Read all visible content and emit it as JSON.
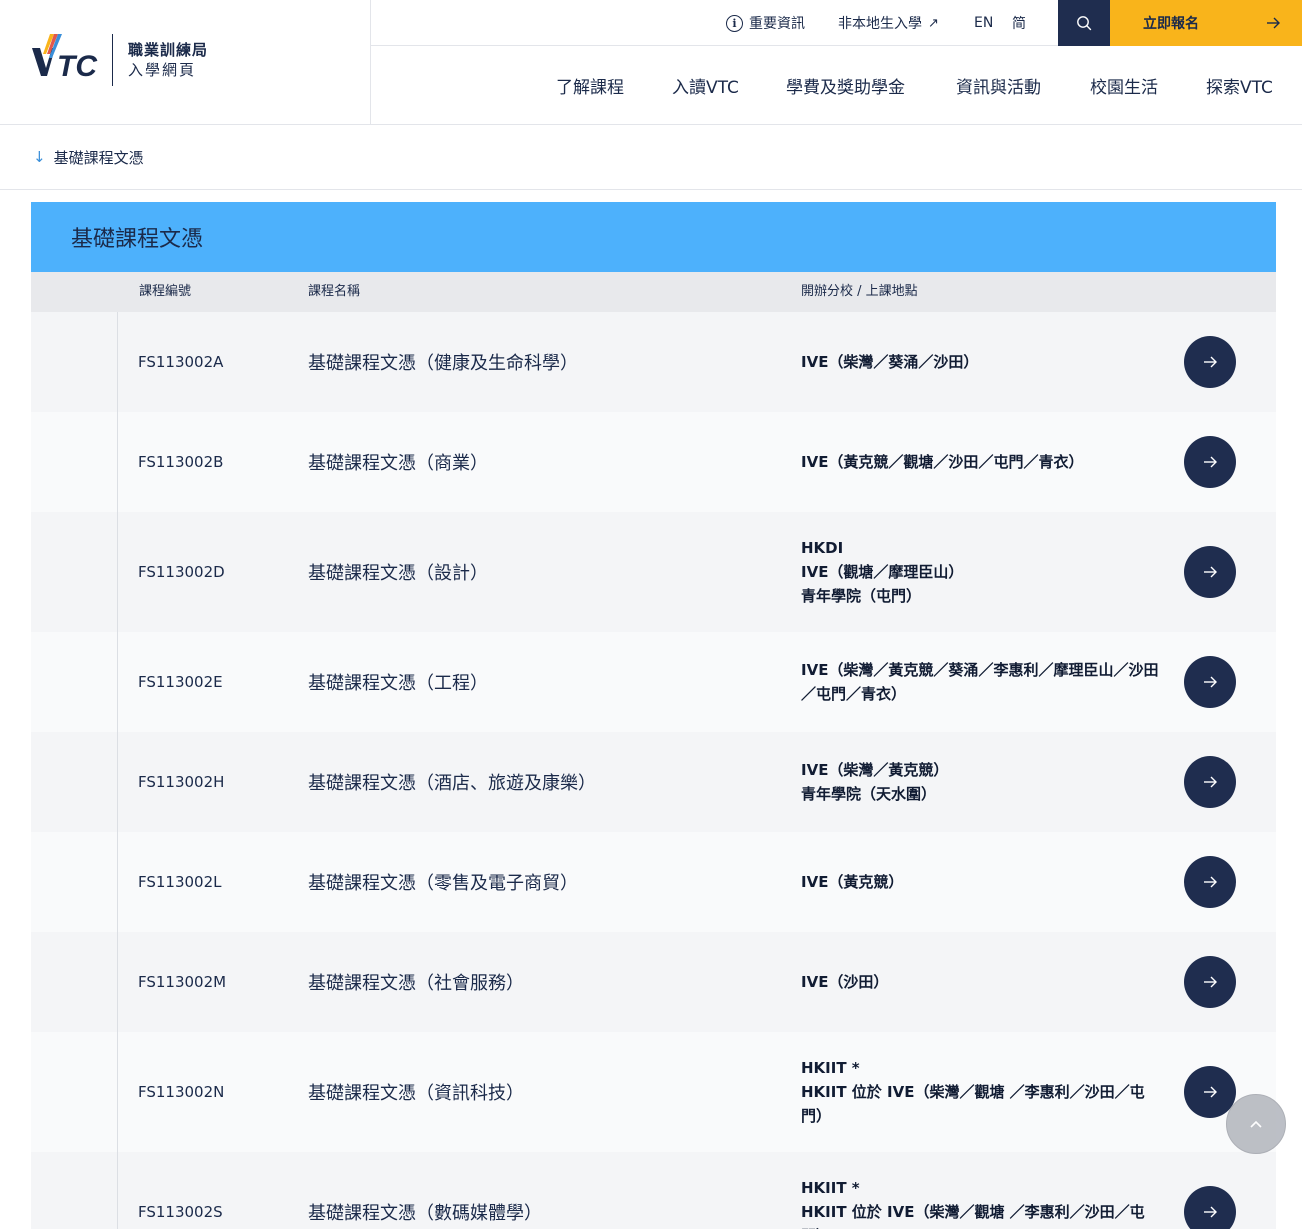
{
  "brand": {
    "logo_text": "VTC",
    "line1": "職業訓練局",
    "line2": "入學網頁",
    "accent_blue": "#4db1fc",
    "navy": "#1f2d4f",
    "yellow": "#f9b41b"
  },
  "topbar": {
    "important_info": "重要資訊",
    "non_local": "非本地生入學",
    "lang_en": "EN",
    "lang_sc": "简",
    "apply_now": "立即報名",
    "icons": [
      "info-icon",
      "external-link-icon",
      "search-icon",
      "arrow-right-icon"
    ]
  },
  "nav": {
    "items": [
      "了解課程",
      "入讀VTC",
      "學費及獎助學金",
      "資訊與活動",
      "校園生活",
      "探索VTC"
    ]
  },
  "anchor": {
    "label": "基礎課程文憑"
  },
  "section": {
    "title": "基礎課程文憑",
    "headers": {
      "code": "課程編號",
      "name": "課程名稱",
      "campus": "開辦分校 / 上課地點"
    },
    "rows": [
      {
        "code": "FS113002A",
        "name": "基礎課程文憑（健康及生命科學）",
        "campus": [
          "IVE（柴灣／葵涌／沙田）"
        ]
      },
      {
        "code": "FS113002B",
        "name": "基礎課程文憑（商業）",
        "campus": [
          "IVE（黃克競／觀塘／沙田／屯門／青衣）"
        ]
      },
      {
        "code": "FS113002D",
        "name": "基礎課程文憑（設計）",
        "campus": [
          "HKDI",
          "IVE（觀塘／摩理臣山）",
          "青年學院（屯門）"
        ]
      },
      {
        "code": "FS113002E",
        "name": "基礎課程文憑（工程）",
        "campus": [
          "IVE（柴灣／黃克競／葵涌／李惠利／摩理臣山／沙田／屯門／青衣）"
        ]
      },
      {
        "code": "FS113002H",
        "name": "基礎課程文憑（酒店、旅遊及康樂）",
        "campus": [
          "IVE（柴灣／黃克競）",
          "青年學院（天水圍）"
        ]
      },
      {
        "code": "FS113002L",
        "name": "基礎課程文憑（零售及電子商貿）",
        "campus": [
          "IVE（黃克競）"
        ]
      },
      {
        "code": "FS113002M",
        "name": "基礎課程文憑（社會服務）",
        "campus": [
          "IVE（沙田）"
        ]
      },
      {
        "code": "FS113002N",
        "name": "基礎課程文憑（資訊科技）",
        "campus": [
          "HKIIT *",
          "HKIIT 位於 IVE（柴灣／觀塘 ／李惠利／沙田／屯門）"
        ]
      },
      {
        "code": "FS113002S",
        "name": "基礎課程文憑（數碼媒體學）",
        "campus": [
          "HKIIT *",
          "HKIIT 位於 IVE（柴灣／觀塘 ／李惠利／沙田／屯門）"
        ]
      }
    ]
  }
}
